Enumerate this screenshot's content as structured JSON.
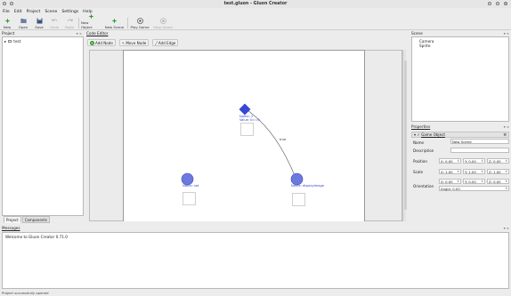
{
  "window": {
    "title": "test.gluon - Gluon Creator"
  },
  "menu": [
    "File",
    "Edit",
    "Project",
    "Scene",
    "Settings",
    "Help"
  ],
  "toolbar": {
    "new": "New",
    "open": "Open",
    "save": "Save",
    "undo": "Undo",
    "redo": "Redo",
    "new_object": "New Object",
    "new_scene": "New Scene",
    "play_game": "Play Game",
    "stop_game": "Stop Game"
  },
  "project_panel": {
    "title": "Project",
    "tree": [
      "test"
    ],
    "tabs": [
      "Project",
      "Components"
    ]
  },
  "code_editor": {
    "title": "Code Editor",
    "buttons": {
      "add_node": "Add Node",
      "move_node": "Move Node",
      "add_edge": "Add Edge"
    },
    "nodes": {
      "diamond": {
        "name": "Name: 2",
        "value": "Value: b==0"
      },
      "set": {
        "name": "Name: set"
      },
      "display": {
        "name": "Name: displayImage"
      }
    },
    "edge_label": "true"
  },
  "scene_panel": {
    "title": "Scene",
    "items": [
      "Camera",
      "Sprite"
    ]
  },
  "properties_panel": {
    "title": "Properties",
    "section": "Game Object",
    "name_label": "Name",
    "name_value": "New Scene",
    "description_label": "Description",
    "position_label": "Position",
    "position": [
      "X: 0.00",
      "Y: 0.00",
      "Z: 0.00"
    ],
    "scale_label": "Scale",
    "scale": [
      "X: 1.00",
      "Y: 1.00",
      "Z: 1.00"
    ],
    "orientation_label": "Orientation",
    "orientation": [
      "X: 0.00",
      "Y: 0.00",
      "Z: 0.00"
    ],
    "angle": "Angle: 0.00"
  },
  "messages_panel": {
    "title": "Messages",
    "text": "Welcome to Gluon Creator 0.71.0"
  },
  "status": "Project successfully opened",
  "colors": {
    "node_blue": "#4a5bd8",
    "diamond_blue": "#3748d6",
    "toolbar_green": "#2f9b2f"
  }
}
